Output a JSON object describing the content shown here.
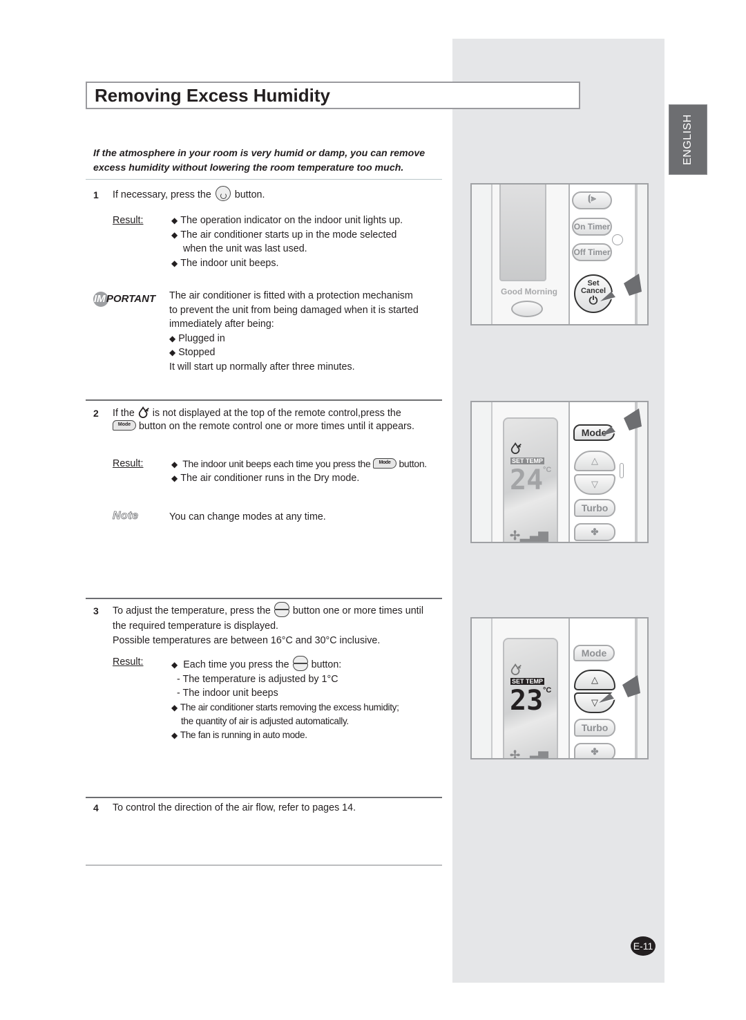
{
  "page": {
    "title": "Removing Excess Humidity",
    "intro": "If the atmosphere in your room is very humid or damp, you can remove excess humidity without lowering the room temperature too much.",
    "language_tab": "ENGLISH",
    "page_number": "E-11"
  },
  "labels": {
    "result": "Result:",
    "important_im": "IM",
    "important_rest": "PORTANT",
    "note": "Note"
  },
  "steps": [
    {
      "number": "1",
      "text_before": "If necessary, press the",
      "icon": "set-cancel-button-icon",
      "text_after": "button.",
      "results": [
        "The operation indicator on the indoor unit lights up.",
        "The air conditioner starts up in the mode selected",
        "when the unit was last used.",
        "The indoor unit beeps."
      ],
      "important": {
        "lines": [
          "The air conditioner is fitted with a protection mechanism",
          "to prevent the unit from being damaged when it is started",
          "immediately after being:"
        ],
        "bullets": [
          "Plugged in",
          "Stopped"
        ],
        "footer": "It will start up normally after three minutes."
      }
    },
    {
      "number": "2",
      "line1_before": "If the",
      "dry_icon": "dry-mode-icon",
      "line1_after": "is not displayed at the top of the remote control,press the",
      "mode_icon_label": "Mode",
      "line2_after": "button on the remote control one or more times until it appears.",
      "results": [
        {
          "before": "The indoor unit beeps each time you press the",
          "icon_label": "Mode",
          "after": "button."
        },
        {
          "before": "The air conditioner runs in the Dry mode."
        }
      ],
      "note": "You can change modes at any time."
    },
    {
      "number": "3",
      "line1_before": "To adjust the temperature, press the",
      "line1_after": "button one or more times until",
      "line2": "the required temperature is displayed.",
      "line3": "Possible temperatures are between 16°C and 30°C inclusive.",
      "results": {
        "first_before": "Each time you press the",
        "first_after": "button:",
        "sub": [
          "- The temperature is adjusted by 1°C",
          "- The indoor unit beeps"
        ],
        "cond1": "The air conditioner starts removing the excess humidity;",
        "cond2": "the quantity of air is adjusted automatically.",
        "cond3": "The fan is running in auto mode."
      }
    },
    {
      "number": "4",
      "text": "To control the direction of the air flow, refer to pages 14."
    }
  ],
  "illustrations": [
    {
      "buttons": [
        "",
        "On Timer",
        "Off Timer"
      ],
      "good_morning": "Good Morning",
      "set_cancel_top": "Set",
      "set_cancel_bottom": "Cancel"
    },
    {
      "buttons": [
        "Mode",
        "△",
        "▽",
        "Turbo"
      ],
      "set_temp": "SET TEMP",
      "temperature": "24",
      "unit": "°C"
    },
    {
      "buttons": [
        "Mode",
        "△",
        "▽",
        "Turbo"
      ],
      "set_temp": "SET TEMP",
      "temperature": "23",
      "unit": "°C"
    }
  ]
}
